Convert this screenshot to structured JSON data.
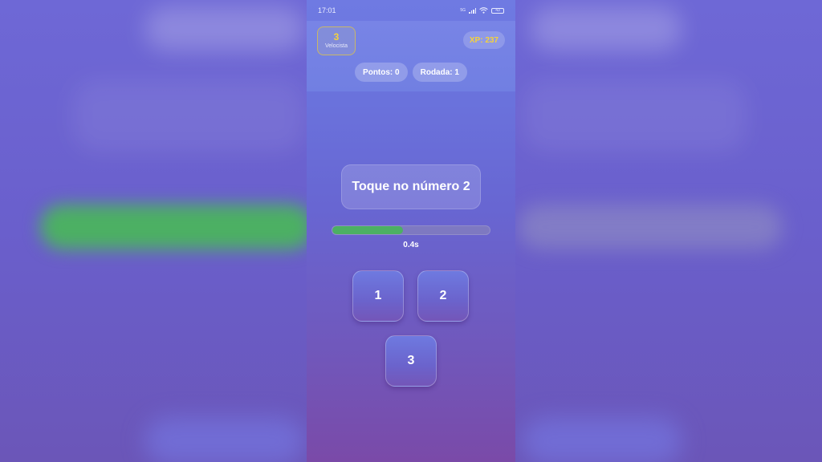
{
  "status_bar": {
    "time": "17:01",
    "network_label": "5G",
    "battery_level": "43",
    "icons": [
      "signal-icon",
      "wifi-icon",
      "battery-icon"
    ]
  },
  "header": {
    "level": {
      "number": "3",
      "title": "Velocista"
    },
    "xp": {
      "label": "XP: ",
      "value": "237"
    },
    "stats": [
      {
        "label": "Pontos: ",
        "value": "0"
      },
      {
        "label": "Rodada: ",
        "value": "1"
      }
    ]
  },
  "game": {
    "prompt": "Toque no número 2",
    "timer": {
      "text": "0.4s",
      "remaining_fraction": 0.45
    },
    "buttons": [
      "1",
      "2",
      "3"
    ]
  },
  "colors": {
    "accent_gold": "#f5d23a",
    "timer_green": "#4cb063",
    "background_top": "#6f7ae2",
    "background_bottom": "#7a4aa8"
  }
}
